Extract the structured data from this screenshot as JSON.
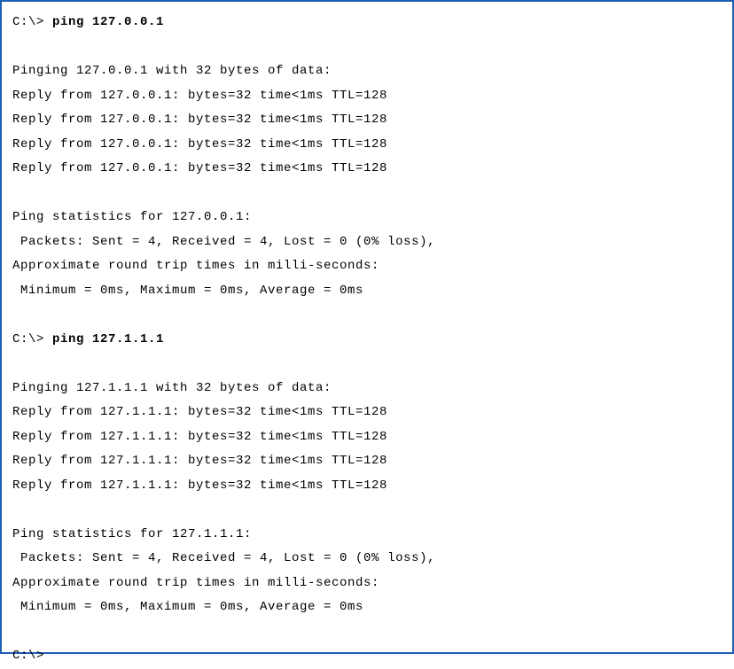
{
  "terminal": {
    "lines": [
      {
        "prompt": "C:\\> ",
        "command": "ping 127.0.0.1"
      },
      {
        "text": ""
      },
      {
        "text": "Pinging 127.0.0.1 with 32 bytes of data:"
      },
      {
        "text": "Reply from 127.0.0.1: bytes=32 time<1ms TTL=128"
      },
      {
        "text": "Reply from 127.0.0.1: bytes=32 time<1ms TTL=128"
      },
      {
        "text": "Reply from 127.0.0.1: bytes=32 time<1ms TTL=128"
      },
      {
        "text": "Reply from 127.0.0.1: bytes=32 time<1ms TTL=128"
      },
      {
        "text": ""
      },
      {
        "text": "Ping statistics for 127.0.0.1:"
      },
      {
        "text": " Packets: Sent = 4, Received = 4, Lost = 0 (0% loss),"
      },
      {
        "text": "Approximate round trip times in milli-seconds:"
      },
      {
        "text": " Minimum = 0ms, Maximum = 0ms, Average = 0ms"
      },
      {
        "text": ""
      },
      {
        "prompt": "C:\\> ",
        "command": "ping 127.1.1.1"
      },
      {
        "text": ""
      },
      {
        "text": "Pinging 127.1.1.1 with 32 bytes of data:"
      },
      {
        "text": "Reply from 127.1.1.1: bytes=32 time<1ms TTL=128"
      },
      {
        "text": "Reply from 127.1.1.1: bytes=32 time<1ms TTL=128"
      },
      {
        "text": "Reply from 127.1.1.1: bytes=32 time<1ms TTL=128"
      },
      {
        "text": "Reply from 127.1.1.1: bytes=32 time<1ms TTL=128"
      },
      {
        "text": ""
      },
      {
        "text": "Ping statistics for 127.1.1.1:"
      },
      {
        "text": " Packets: Sent = 4, Received = 4, Lost = 0 (0% loss),"
      },
      {
        "text": "Approximate round trip times in milli-seconds:"
      },
      {
        "text": " Minimum = 0ms, Maximum = 0ms, Average = 0ms"
      },
      {
        "text": ""
      },
      {
        "prompt": "C:\\>",
        "command": ""
      }
    ]
  }
}
